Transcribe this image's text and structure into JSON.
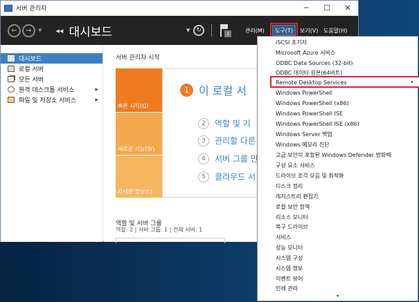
{
  "window": {
    "title": "서버 관리자",
    "controls": {
      "minimize": "─",
      "maximize": "☐",
      "close": "✕"
    }
  },
  "header": {
    "breadcrumb_chevron": "◂◂",
    "breadcrumb": "대시보드",
    "notification_count": "1",
    "menus": {
      "manage": "관리(M)",
      "tools": "도구(T)",
      "view": "보기(V)",
      "help": "도움말(H)"
    }
  },
  "sidebar": {
    "items": [
      {
        "label": "대시보드",
        "icon": "dashboard-icon",
        "active": true
      },
      {
        "label": "로컬 서버",
        "icon": "server-icon"
      },
      {
        "label": "모든 서버",
        "icon": "servers-icon"
      },
      {
        "label": "원격 데스크톱 서비스",
        "icon": "remote-desktop-icon",
        "expandable": true
      },
      {
        "label": "파일 및 저장소 서비스",
        "icon": "storage-icon",
        "expandable": true
      }
    ]
  },
  "main": {
    "section_title": "서버 관리자 시작",
    "tiles": {
      "quick_start": "빠른 시작(Q)",
      "whats_new": "새로운 기능(W)",
      "learn_more": "자세한 정보(L)"
    },
    "steps": [
      {
        "num": "1",
        "text": "이 로컬 서"
      },
      {
        "num": "2",
        "text": "역할 및 기"
      },
      {
        "num": "3",
        "text": "관리할 다른"
      },
      {
        "num": "4",
        "text": "서버 그룹 만"
      },
      {
        "num": "5",
        "text": "클라우드 서"
      }
    ],
    "roles_title": "역할 및 서버 그룹",
    "roles_summary": "역할: 2   |   서버 그룹: 1   |   전체 서버: 1"
  },
  "tools_menu": {
    "items": [
      "iSCSI 초기자",
      "Microsoft Azure 서비스",
      "ODBC Data Sources (32-bit)",
      "ODBC 데이터 원본(64비트)",
      "Remote Desktop Services",
      "Windows PowerShell",
      "Windows PowerShell (x86)",
      "Windows PowerShell ISE",
      "Windows PowerShell ISE (x86)",
      "Windows Server 백업",
      "Windows 메모리 진단",
      "고급 보안이 포함된 Windows Defender 방화벽",
      "구성 요소 서비스",
      "드라이브 조각 모음 및 최적화",
      "디스크 정리",
      "레지스트리 편집기",
      "로컬 보안 정책",
      "리소스 모니터",
      "복구 드라이브",
      "서비스",
      "성능 모니터",
      "시스템 구성",
      "시스템 정보",
      "이벤트 뷰어",
      "인쇄 관리"
    ],
    "submenu_arrow": "▸",
    "scroll_arrow": "▾"
  },
  "colors": {
    "accent": "#3c7fc7",
    "highlight_border": "#d9262e",
    "tile_orange": "#f07a20",
    "header_bg": "#232323"
  }
}
